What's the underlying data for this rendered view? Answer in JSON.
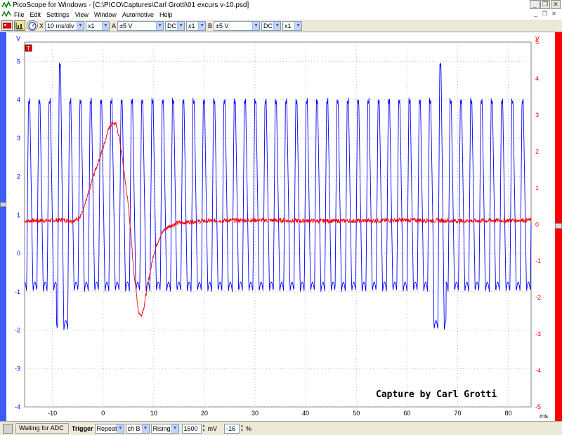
{
  "window": {
    "title": "PicoScope for Windows - [C:\\PICO\\Captures\\Carl Grotti\\01 excurs v-10.psd]",
    "minimize": "_",
    "restore": "❐",
    "close": "✕"
  },
  "menu": {
    "items": [
      "File",
      "Edit",
      "Settings",
      "View",
      "Window",
      "Automotive",
      "Help"
    ],
    "mdi_minimize": "_",
    "mdi_restore": "❐",
    "mdi_close": "✕"
  },
  "toolbar": {
    "timebase": "10 ms/div",
    "zoom": "x1",
    "channel_a_label": "A",
    "channel_a_range": "±5 V",
    "channel_a_coupling": "DC",
    "channel_a_mult": "x1",
    "channel_b_label": "B",
    "channel_b_range": "±5 V",
    "channel_b_coupling": "DC",
    "channel_b_mult": "x1",
    "close_x": "X"
  },
  "scope": {
    "left_unit": "V",
    "right_unit": "V",
    "x_unit": "ms",
    "trigger_marker": "T",
    "watermark": "Capture by Carl Grotti",
    "colors": {
      "channel_a": "#0000ff",
      "channel_b": "#ff0000",
      "grid": "#bdbdbd"
    }
  },
  "chart_data": {
    "type": "line",
    "x_ticks": [
      -10,
      0,
      10,
      20,
      30,
      40,
      50,
      60,
      70,
      80
    ],
    "xlim": [
      -15.5,
      84.5
    ],
    "left_axis": {
      "ticks": [
        5,
        4,
        3,
        2,
        1,
        0,
        -1,
        -2,
        -3,
        -4
      ],
      "ylim": [
        -4,
        5.5
      ]
    },
    "right_axis": {
      "ticks": [
        5,
        4,
        3,
        2,
        1,
        0,
        -1,
        -2,
        -3,
        -4,
        -5
      ],
      "ylim": [
        -5,
        5
      ]
    },
    "grid": true,
    "series": [
      {
        "channel": "A",
        "axis": "left",
        "color": "#0000ff",
        "pattern": {
          "type": "periodic",
          "period_ms": 2.03,
          "high": 4.05,
          "low": -1.0,
          "phase_ms": -15.1
        },
        "excursions": [
          {
            "x": -8.0,
            "high": 5.0,
            "low": -2.0
          },
          {
            "x": 66.5,
            "high": 5.0,
            "low": -2.0
          }
        ]
      },
      {
        "channel": "B",
        "axis": "right",
        "color": "#ff0000",
        "points": [
          [
            -15.5,
            0.1
          ],
          [
            -8,
            0.12
          ],
          [
            -6,
            0.1
          ],
          [
            -5,
            0.15
          ],
          [
            -4,
            0.35
          ],
          [
            -3,
            0.8
          ],
          [
            -2,
            1.3
          ],
          [
            -1,
            1.7
          ],
          [
            0,
            2.1
          ],
          [
            1,
            2.6
          ],
          [
            1.8,
            2.8
          ],
          [
            2.5,
            2.75
          ],
          [
            3.2,
            2.4
          ],
          [
            4,
            1.6
          ],
          [
            5,
            0.5
          ],
          [
            5.5,
            -0.3
          ],
          [
            6,
            -1.2
          ],
          [
            6.5,
            -1.8
          ],
          [
            7,
            -2.4
          ],
          [
            7.5,
            -2.5
          ],
          [
            8,
            -2.3
          ],
          [
            8.5,
            -1.9
          ],
          [
            9,
            -1.5
          ],
          [
            10,
            -0.8
          ],
          [
            11,
            -0.4
          ],
          [
            12,
            -0.15
          ],
          [
            13,
            -0.05
          ],
          [
            15,
            0.05
          ],
          [
            20,
            0.1
          ],
          [
            30,
            0.12
          ],
          [
            40,
            0.1
          ],
          [
            50,
            0.1
          ],
          [
            60,
            0.12
          ],
          [
            70,
            0.1
          ],
          [
            84.5,
            0.12
          ]
        ]
      }
    ]
  },
  "status": {
    "state": "Waiting for ADC",
    "trigger_label": "Trigger",
    "trigger_mode": "Repeat",
    "trigger_source": "ch B",
    "trigger_edge": "Rising",
    "trigger_level": "1600",
    "level_unit": "mV",
    "delay": "-16",
    "delay_unit": "%"
  }
}
